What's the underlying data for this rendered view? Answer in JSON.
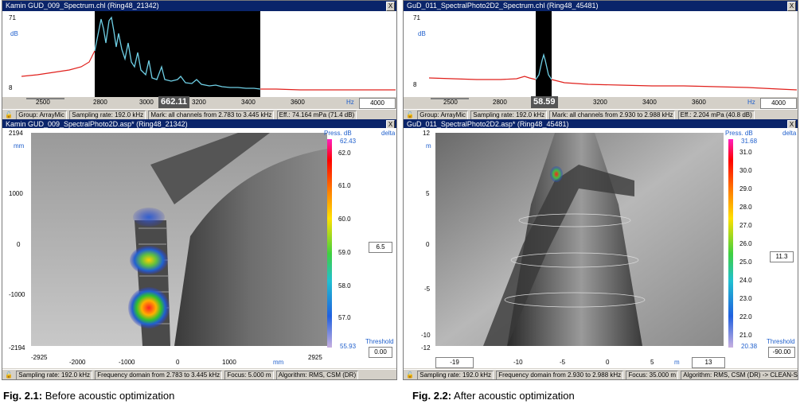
{
  "left": {
    "title": "Kamin GUD_009_Spectrum.chl (Ring48_21342)",
    "close": "X",
    "spectrum": {
      "ymax": "71",
      "yunit": "dB",
      "ymin": "8",
      "xticks": [
        "2500",
        "2800",
        "3000",
        "3200",
        "3400",
        "3600",
        "4000"
      ],
      "xunit": "Hz",
      "cursor": "662.11"
    },
    "status1": [
      "Group: ArrayMic",
      "Sampling rate: 192.0 kHz",
      "Mark: all channels from 2.783 to 3.445 kHz",
      "Eff.: 74.164 mPa (71.4 dB)"
    ],
    "photo_title": "Kamin GUD_009_SpectralPhoto2D.asp* (Ring48_21342)",
    "yticks": [
      "2194",
      "mm",
      "1000",
      "0",
      "-1000",
      "-2194"
    ],
    "xticks": [
      "-2925",
      "-2000",
      "-1000",
      "0",
      "1000",
      "mm",
      "2925"
    ],
    "legend_title": "Press. dB",
    "delta_label": "delta",
    "legend_top": "62.43",
    "legend_ticks": [
      "62.0",
      "61.0",
      "60.0",
      "59.0",
      "58.0",
      "57.0"
    ],
    "legend_bottom": "55.93",
    "delta_value": "6.5",
    "threshold_label": "Threshold",
    "threshold_value": "0.00",
    "status2": [
      "Sampling rate: 192.0 kHz",
      "Frequency domain from 2.783 to 3.445 kHz",
      "Focus: 5.000 m",
      "Algorithm: RMS, CSM (DR)"
    ]
  },
  "right": {
    "title": "GuD_011_SpectralPhoto2D2_Spectrum.chl (Ring48_45481)",
    "close": "X",
    "spectrum": {
      "ymax": "71",
      "yunit": "dB",
      "ymin": "8",
      "xticks": [
        "2500",
        "2800",
        "3200",
        "3400",
        "3600",
        "4000"
      ],
      "xunit": "Hz",
      "cursor": "58.59"
    },
    "status1": [
      "Group: ArrayMic",
      "Sampling rate: 192.0 kHz",
      "Mark: all channels from 2.930 to 2.988 kHz",
      "Eff.: 2.204 mPa (40.8 dB)"
    ],
    "photo_title": "GuD_011_SpectralPhoto2D2.asp* (Ring48_45481)",
    "yticks": [
      "12",
      "m",
      "5",
      "0",
      "-5",
      "-10",
      "-12"
    ],
    "xticks": [
      "-19",
      "-10",
      "-5",
      "0",
      "5",
      "m",
      "13"
    ],
    "legend_title": "Press. dB",
    "delta_label": "delta",
    "legend_top": "31.68",
    "legend_ticks": [
      "31.0",
      "30.0",
      "29.0",
      "28.0",
      "27.0",
      "26.0",
      "25.0",
      "24.0",
      "23.0",
      "22.0",
      "21.0"
    ],
    "legend_bottom": "20.38",
    "delta_value": "11.3",
    "threshold_label": "Threshold",
    "threshold_value": "-90.00",
    "status2": [
      "Sampling rate: 192.0 kHz",
      "Frequency domain from 2.930 to 2.988 kHz",
      "Focus: 35.000 m",
      "Algorithm: RMS, CSM (DR) -> CLEAN-SC"
    ]
  },
  "captions": [
    {
      "prefix": "Fig. 2.1:",
      "text": " Before acoustic optimization"
    },
    {
      "prefix": "Fig. 2.2:",
      "text": " After acoustic optimization"
    }
  ],
  "colors": {
    "titlebar": "#0a246a",
    "spectrum_red": "#e0201c",
    "spectrum_cyan": "#6fd0e6",
    "panel_bg": "#d4d0c8"
  }
}
